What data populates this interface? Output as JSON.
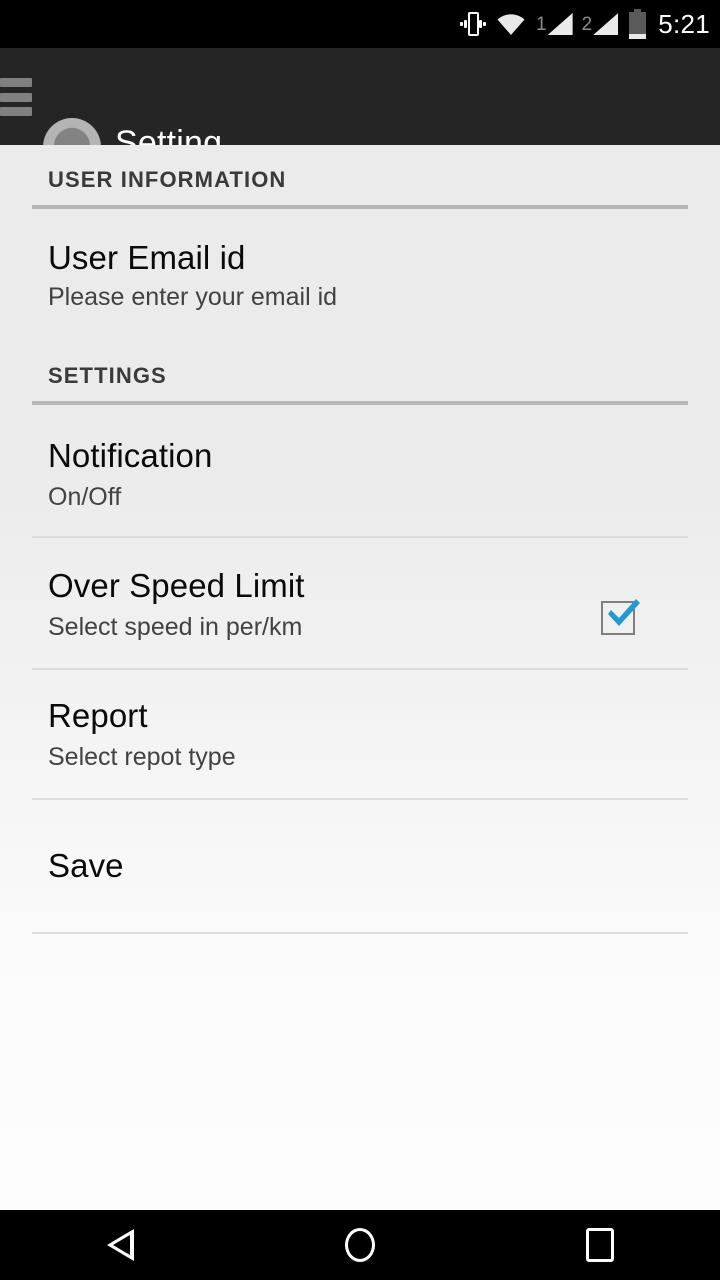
{
  "status_bar": {
    "time": "5:21",
    "icons": [
      {
        "name": "vibrate-icon",
        "label": "vibrate"
      },
      {
        "name": "wifi-icon",
        "label": "wifi"
      },
      {
        "name": "signal-sim1-icon",
        "label": "1"
      },
      {
        "name": "signal-sim2-icon",
        "label": "2"
      },
      {
        "name": "battery-icon",
        "label": "battery"
      }
    ],
    "sim1_label": "1",
    "sim2_label": "2"
  },
  "action_bar": {
    "title": "Setting",
    "menu_icon": "hamburger-menu-icon",
    "avatar_icon": "user-avatar"
  },
  "sections": [
    {
      "header": "USER INFORMATION",
      "rows": [
        {
          "title": "User Email id",
          "subtitle": "Please enter your email id",
          "control": "none"
        }
      ]
    },
    {
      "header": "SETTINGS",
      "rows": [
        {
          "title": "Notification",
          "subtitle": "On/Off",
          "control": "checkbox",
          "checked": true
        },
        {
          "title": "Over Speed Limit",
          "subtitle": "Select speed in per/km",
          "control": "none"
        },
        {
          "title": "Report",
          "subtitle": "Select repot type",
          "control": "none"
        },
        {
          "title": "Save",
          "subtitle": "",
          "control": "none"
        }
      ]
    }
  ],
  "nav_bar": {
    "back": "back-button",
    "home": "home-button",
    "recents": "recents-button"
  },
  "colors": {
    "status_bar_bg": "#000000",
    "action_bar_bg": "#252525",
    "content_bg_top": "#ebebeb",
    "content_bg_bottom": "#fdfdfd",
    "accent_checkbox": "#1f9bd1",
    "section_rule": "#b6b6b6",
    "row_rule": "#dcdcdc"
  }
}
